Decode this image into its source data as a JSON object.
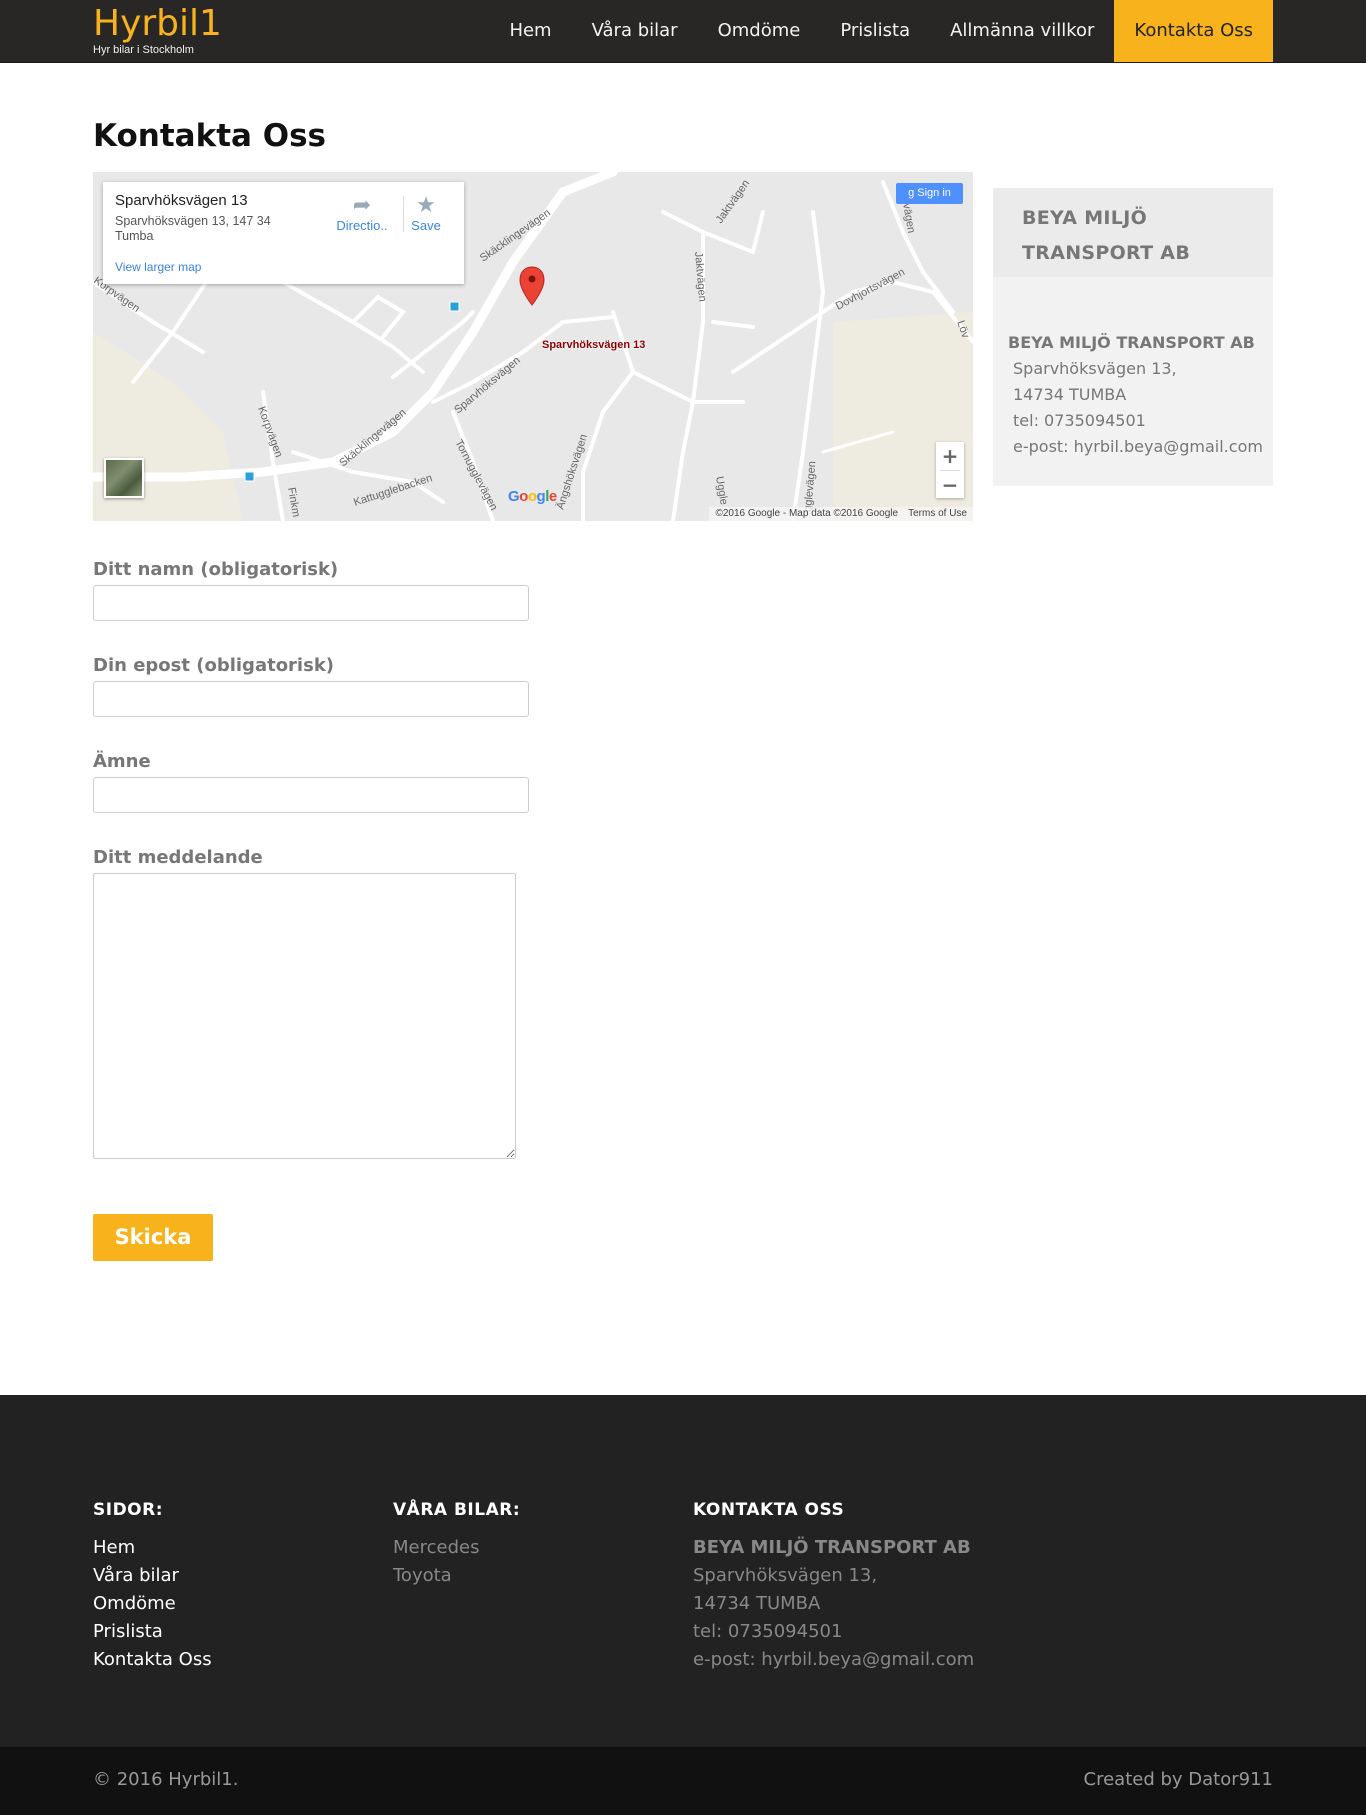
{
  "header": {
    "brand": "Hyrbil1",
    "tagline": "Hyr bilar i Stockholm",
    "nav": [
      {
        "label": "Hem"
      },
      {
        "label": "Våra bilar"
      },
      {
        "label": "Omdöme"
      },
      {
        "label": "Prislista"
      },
      {
        "label": "Allmänna villkor"
      },
      {
        "label": "Kontakta Oss"
      }
    ],
    "active_index": 5
  },
  "page": {
    "title": "Kontakta Oss"
  },
  "map": {
    "card_title": "Sparvhöksvägen 13",
    "card_address": "Sparvhöksvägen 13, 147 34 Tumba",
    "view_larger": "View larger map",
    "directions": "Directio..",
    "save": "Save",
    "sign_in": "Sign in",
    "pin_label": "Sparvhöksvägen 13",
    "zoom_in": "+",
    "zoom_out": "−",
    "copyright": "©2016 Google - Map data ©2016 Google",
    "terms": "Terms of Use",
    "google_logo": "Google",
    "street_labels": [
      "Skäcklingevägen",
      "Jaktvägen",
      "Korpvägen",
      "Jaktvägen",
      "Dovhjortsvägen",
      "Sparvhöksvägen",
      "Korpvägen",
      "Skäcklingevägen",
      "Kattugglebacken",
      "Tornugglevägen",
      "Ängshöksvägen",
      "Uggle",
      "gglevägen",
      "Finkm",
      "Löv",
      "envägen"
    ]
  },
  "sidebar": {
    "heading": "BEYA MILJÖ TRANSPORT AB",
    "company": "BEYA MILJÖ TRANSPORT AB",
    "lines": [
      "Sparvhöksvägen 13,",
      "14734 TUMBA",
      "tel: 0735094501",
      "e-post: hyrbil.beya@gmail.com"
    ]
  },
  "form": {
    "name_label": "Ditt namn (obligatorisk)",
    "email_label": "Din epost (obligatorisk)",
    "subject_label": "Ämne",
    "message_label": "Ditt meddelande",
    "name_value": "",
    "email_value": "",
    "subject_value": "",
    "message_value": "",
    "submit": "Skicka"
  },
  "footer": {
    "col1_title": "SIDOR:",
    "col1_links": [
      "Hem",
      "Våra bilar",
      "Omdöme",
      "Prislista",
      "Kontakta Oss"
    ],
    "col2_title": "VÅRA BILAR:",
    "col2_links": [
      "Mercedes",
      "Toyota"
    ],
    "col3_title": "KONTAKTA OSS",
    "col3_company": "BEYA MILJÖ TRANSPORT AB",
    "col3_lines": [
      "Sparvhöksvägen 13,",
      "14734 TUMBA",
      "tel: 0735094501",
      "e-post: hyrbil.beya@gmail.com"
    ],
    "copyright": "© 2016 Hyrbil1.",
    "credit": "Created by Dator911"
  },
  "colors": {
    "accent": "#f8b31c",
    "header_bg": "#282726",
    "footer_bg": "#222222",
    "bottom_bg": "#111111"
  },
  "icons": {
    "directions": "directions-icon",
    "save": "star-icon",
    "sign_in": "google-plus-icon",
    "pin": "map-pin-icon"
  }
}
